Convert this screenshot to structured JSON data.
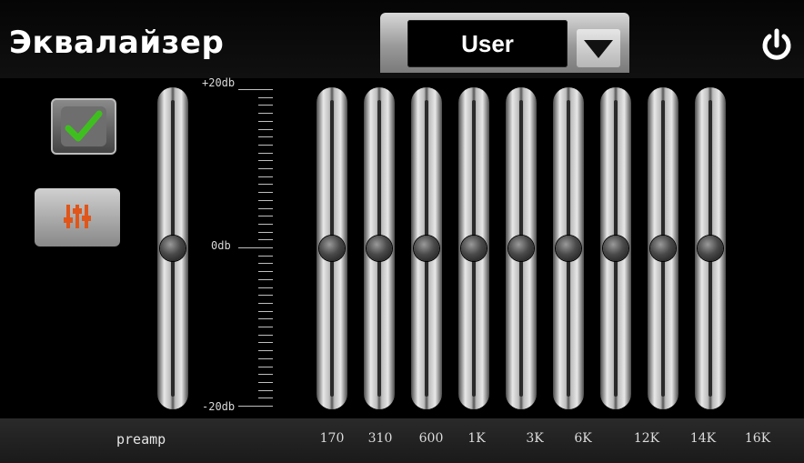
{
  "header": {
    "title": "Эквалайзер",
    "preset_value": "User",
    "icons": {
      "dropdown": "chevron-down-icon",
      "power": "power-icon"
    }
  },
  "sidebar": {
    "apply_icon": "checkmark-icon",
    "mixer_icon": "equalizer-sliders-icon"
  },
  "scale": {
    "top": "+20db",
    "middle": "0db",
    "bottom": "-20db"
  },
  "preamp": {
    "label": "preamp",
    "value_db": 0
  },
  "bands": [
    {
      "label": "170",
      "value_db": 0
    },
    {
      "label": "310",
      "value_db": 0
    },
    {
      "label": "600",
      "value_db": 0
    },
    {
      "label": "1K",
      "value_db": 0
    },
    {
      "label": "3K",
      "value_db": 0
    },
    {
      "label": "6K",
      "value_db": 0
    },
    {
      "label": "12K",
      "value_db": 0
    },
    {
      "label": "14K",
      "value_db": 0
    },
    {
      "label": "16K",
      "value_db": 0
    }
  ],
  "colors": {
    "accent_check": "#3fbf1f",
    "mixer_icon": "#e0561a",
    "background": "#000000"
  }
}
